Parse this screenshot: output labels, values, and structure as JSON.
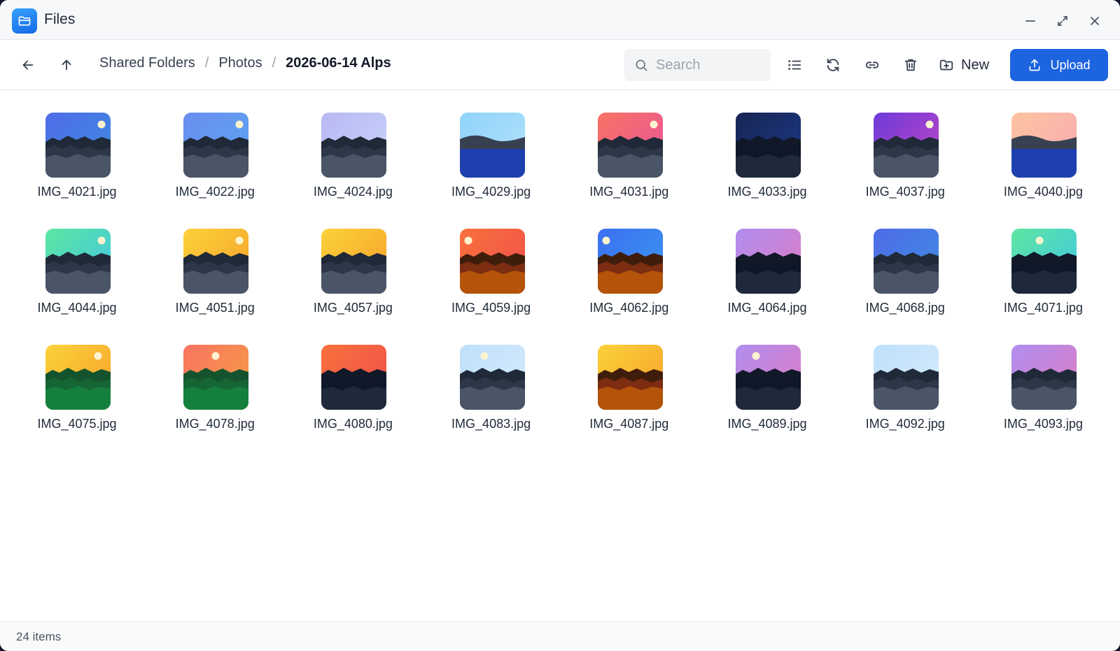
{
  "window": {
    "title": "Files"
  },
  "breadcrumb": [
    "Shared Folders",
    "Photos",
    "2026-06-14 Alps"
  ],
  "search": {
    "placeholder": "Search",
    "value": ""
  },
  "toolbar": {
    "new_label": "New",
    "upload_label": "Upload"
  },
  "files": [
    {
      "name": "IMG_4021.jpg",
      "sky": [
        "#4f6be8",
        "#3d8fe0"
      ],
      "ground": [
        "#4a5568",
        "#2d3748",
        "#1f2937"
      ],
      "sun": true,
      "water": false
    },
    {
      "name": "IMG_4022.jpg",
      "sky": [
        "#6b8df0",
        "#5aa8f2"
      ],
      "ground": [
        "#4a5568",
        "#2d3748",
        "#1f2937"
      ],
      "sun": true,
      "water": false
    },
    {
      "name": "IMG_4024.jpg",
      "sky": [
        "#b8b8f2",
        "#c9d6fb"
      ],
      "ground": [
        "#4a5568",
        "#2d3748",
        "#1f2937"
      ],
      "sun": false,
      "water": false
    },
    {
      "name": "IMG_4029.jpg",
      "sky": [
        "#8fd3fa",
        "#b6e2fb"
      ],
      "ground": [
        "#1e40af",
        "#374151",
        "#374151"
      ],
      "sun": false,
      "water": true
    },
    {
      "name": "IMG_4031.jpg",
      "sky": [
        "#f97362",
        "#e852a0"
      ],
      "ground": [
        "#4a5568",
        "#2d3748",
        "#1f2937"
      ],
      "sun": true,
      "water": false
    },
    {
      "name": "IMG_4033.jpg",
      "sky": [
        "#172554",
        "#1e3a8a"
      ],
      "ground": [
        "#1e293b",
        "#0f172a",
        "#111827"
      ],
      "sun": false,
      "water": false
    },
    {
      "name": "IMG_4037.jpg",
      "sky": [
        "#6d3ad8",
        "#c548c6"
      ],
      "ground": [
        "#4a5568",
        "#2d3748",
        "#1f2937"
      ],
      "sun": true,
      "water": false
    },
    {
      "name": "IMG_4040.jpg",
      "sky": [
        "#fdc3a0",
        "#f7a9b4"
      ],
      "ground": [
        "#1e40af",
        "#374151",
        "#374151"
      ],
      "sun": false,
      "water": true
    },
    {
      "name": "IMG_4044.jpg",
      "sky": [
        "#5ee6a0",
        "#3fc5e8"
      ],
      "ground": [
        "#4a5568",
        "#2d3748",
        "#1f2937"
      ],
      "sun": true,
      "water": false
    },
    {
      "name": "IMG_4051.jpg",
      "sky": [
        "#fcd23a",
        "#f59e2a"
      ],
      "ground": [
        "#4a5568",
        "#2d3748",
        "#1f2937"
      ],
      "sun": true,
      "water": false
    },
    {
      "name": "IMG_4057.jpg",
      "sky": [
        "#fcd23a",
        "#f59e2a"
      ],
      "ground": [
        "#4a5568",
        "#2d3748",
        "#1f2937"
      ],
      "sun": false,
      "water": false
    },
    {
      "name": "IMG_4059.jpg",
      "sky": [
        "#f9713c",
        "#ee4d4d"
      ],
      "ground": [
        "#b45309",
        "#7c2d12",
        "#3f1d0b"
      ],
      "sun": true,
      "water": false
    },
    {
      "name": "IMG_4062.jpg",
      "sky": [
        "#3b6ff0",
        "#3b9af0"
      ],
      "ground": [
        "#b45309",
        "#7c2d12",
        "#3f1d0b"
      ],
      "sun": true,
      "water": false
    },
    {
      "name": "IMG_4064.jpg",
      "sky": [
        "#b08ef0",
        "#e27ac0"
      ],
      "ground": [
        "#1e293b",
        "#0f172a",
        "#111827"
      ],
      "sun": false,
      "water": false
    },
    {
      "name": "IMG_4068.jpg",
      "sky": [
        "#4f6be8",
        "#3d8fe0"
      ],
      "ground": [
        "#4a5568",
        "#2d3748",
        "#1f2937"
      ],
      "sun": false,
      "water": false
    },
    {
      "name": "IMG_4071.jpg",
      "sky": [
        "#5ee6a0",
        "#3fc5e8"
      ],
      "ground": [
        "#1e293b",
        "#0f172a",
        "#111827"
      ],
      "sun": true,
      "water": false
    },
    {
      "name": "IMG_4075.jpg",
      "sky": [
        "#fcd23a",
        "#f59e2a"
      ],
      "ground": [
        "#15803d",
        "#166534",
        "#14532d"
      ],
      "sun": true,
      "water": false
    },
    {
      "name": "IMG_4078.jpg",
      "sky": [
        "#f97362",
        "#f5a340"
      ],
      "ground": [
        "#15803d",
        "#166534",
        "#14532d"
      ],
      "sun": true,
      "water": false
    },
    {
      "name": "IMG_4080.jpg",
      "sky": [
        "#f9713c",
        "#ee4d4d"
      ],
      "ground": [
        "#1e293b",
        "#0f172a",
        "#111827"
      ],
      "sun": false,
      "water": false
    },
    {
      "name": "IMG_4083.jpg",
      "sky": [
        "#bfe0fb",
        "#d7ebfc"
      ],
      "ground": [
        "#4a5568",
        "#2d3748",
        "#1f2937"
      ],
      "sun": true,
      "water": false
    },
    {
      "name": "IMG_4087.jpg",
      "sky": [
        "#fcd23a",
        "#f59e2a"
      ],
      "ground": [
        "#b45309",
        "#7c2d12",
        "#3f1d0b"
      ],
      "sun": false,
      "water": false
    },
    {
      "name": "IMG_4089.jpg",
      "sky": [
        "#b08ef0",
        "#e27ac0"
      ],
      "ground": [
        "#1e293b",
        "#0f172a",
        "#111827"
      ],
      "sun": true,
      "water": false
    },
    {
      "name": "IMG_4092.jpg",
      "sky": [
        "#bfe0fb",
        "#d7ebfc"
      ],
      "ground": [
        "#4a5568",
        "#2d3748",
        "#1f2937"
      ],
      "sun": false,
      "water": false
    },
    {
      "name": "IMG_4093.jpg",
      "sky": [
        "#b08ef0",
        "#e27ac0"
      ],
      "ground": [
        "#4a5568",
        "#2d3748",
        "#1f2937"
      ],
      "sun": false,
      "water": false
    }
  ],
  "status": {
    "item_count": "24 items"
  },
  "colors": {
    "accent": "#1d64e0",
    "app_icon": "#1a7cf2"
  },
  "icons": {
    "back": "arrow-left-icon",
    "up": "arrow-up-icon",
    "search": "search-icon",
    "list": "list-view-icon",
    "refresh": "refresh-icon",
    "link": "link-icon",
    "delete": "trash-icon",
    "new": "new-folder-icon",
    "upload": "upload-icon",
    "minimize": "minimize-icon",
    "maximize": "maximize-icon",
    "close": "close-icon"
  }
}
